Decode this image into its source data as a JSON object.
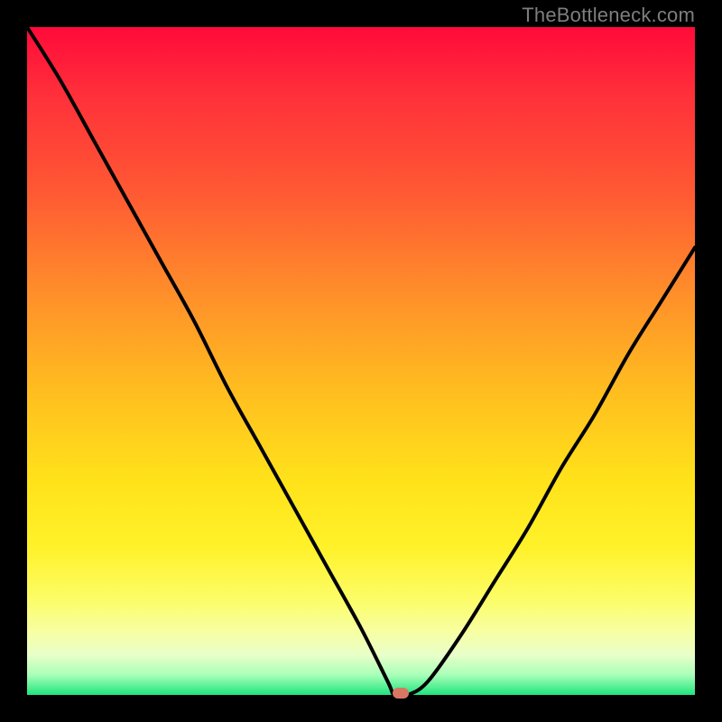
{
  "watermark": {
    "text": "TheBottleneck.com"
  },
  "colors": {
    "curve": "#000000",
    "marker": "#d97763",
    "background_black": "#000000"
  },
  "chart_data": {
    "type": "line",
    "title": "",
    "xlabel": "",
    "ylabel": "",
    "xlim": [
      0,
      100
    ],
    "ylim": [
      0,
      100
    ],
    "grid": false,
    "legend": false,
    "annotations": [
      "TheBottleneck.com"
    ],
    "series": [
      {
        "name": "bottleneck-curve",
        "x": [
          0,
          5,
          10,
          15,
          20,
          25,
          30,
          35,
          40,
          45,
          50,
          54,
          55,
          57,
          60,
          65,
          70,
          75,
          80,
          85,
          90,
          95,
          100
        ],
        "values": [
          100,
          92,
          83,
          74,
          65,
          56,
          46,
          37,
          28,
          19,
          10,
          2,
          0,
          0,
          2,
          9,
          17,
          25,
          34,
          42,
          51,
          59,
          67
        ]
      }
    ],
    "optimum_marker": {
      "x": 56,
      "y": 0
    },
    "background_gradient_stops": [
      {
        "pos": 0,
        "color": "#ff0a3a"
      },
      {
        "pos": 10,
        "color": "#ff2f3a"
      },
      {
        "pos": 25,
        "color": "#ff5a33"
      },
      {
        "pos": 40,
        "color": "#ff8f2a"
      },
      {
        "pos": 55,
        "color": "#ffbf1f"
      },
      {
        "pos": 68,
        "color": "#ffe21a"
      },
      {
        "pos": 78,
        "color": "#fff22a"
      },
      {
        "pos": 86,
        "color": "#fcfd6a"
      },
      {
        "pos": 91,
        "color": "#f6ffa8"
      },
      {
        "pos": 94,
        "color": "#e9ffc9"
      },
      {
        "pos": 97,
        "color": "#a9ffb8"
      },
      {
        "pos": 100,
        "color": "#1fe57e"
      }
    ]
  }
}
